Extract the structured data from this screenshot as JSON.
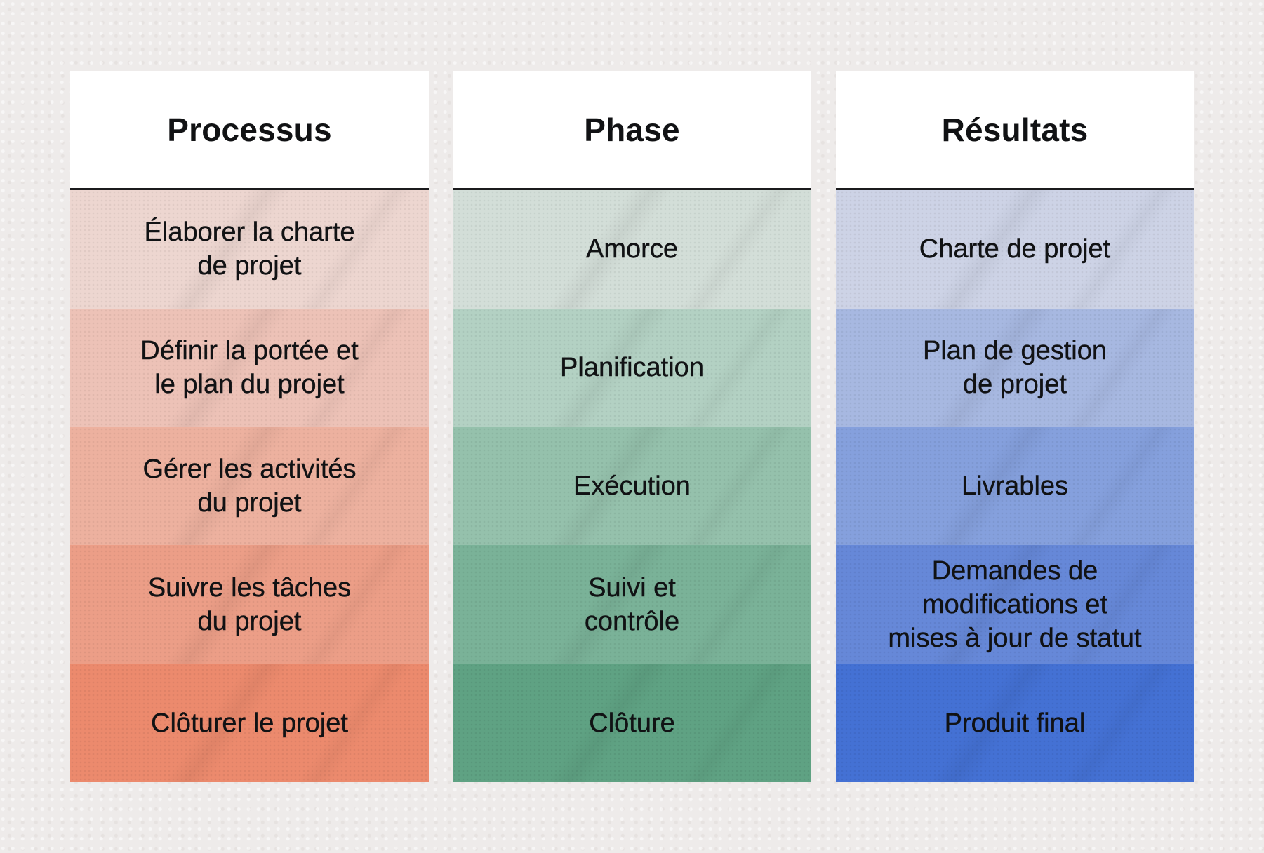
{
  "columns": [
    {
      "id": "processus",
      "header": "Processus",
      "cells": [
        {
          "text": "Élaborer la charte\nde projet",
          "color": "#EDD6D0"
        },
        {
          "text": "Définir la portée et\nle plan du projet",
          "color": "#EDC2B7"
        },
        {
          "text": "Gérer les activités\ndu projet",
          "color": "#EDB19F"
        },
        {
          "text": "Suivre les tâches\ndu projet",
          "color": "#EC9E87"
        },
        {
          "text": "Clôturer le projet",
          "color": "#EC8A6D"
        }
      ]
    },
    {
      "id": "phase",
      "header": "Phase",
      "cells": [
        {
          "text": "Amorce",
          "color": "#D3DED8"
        },
        {
          "text": "Planification",
          "color": "#B3D1C3"
        },
        {
          "text": "Exécution",
          "color": "#95C1AC"
        },
        {
          "text": "Suivi et\ncontrôle",
          "color": "#7AB298"
        },
        {
          "text": "Clôture",
          "color": "#5FA283"
        }
      ]
    },
    {
      "id": "resultats",
      "header": "Résultats",
      "cells": [
        {
          "text": "Charte de projet",
          "color": "#CDD3E6"
        },
        {
          "text": "Plan de gestion\nde projet",
          "color": "#A7B8E1"
        },
        {
          "text": "Livrables",
          "color": "#85A0DD"
        },
        {
          "text": "Demandes de\nmodifications et\nmises à jour de statut",
          "color": "#6688D8"
        },
        {
          "text": "Produit final",
          "color": "#4471D4"
        }
      ]
    }
  ],
  "colors": {
    "background": "#EEEBEA",
    "header_background": "#FFFFFF",
    "header_rule": "#1B1B1D",
    "text": "#111214"
  }
}
